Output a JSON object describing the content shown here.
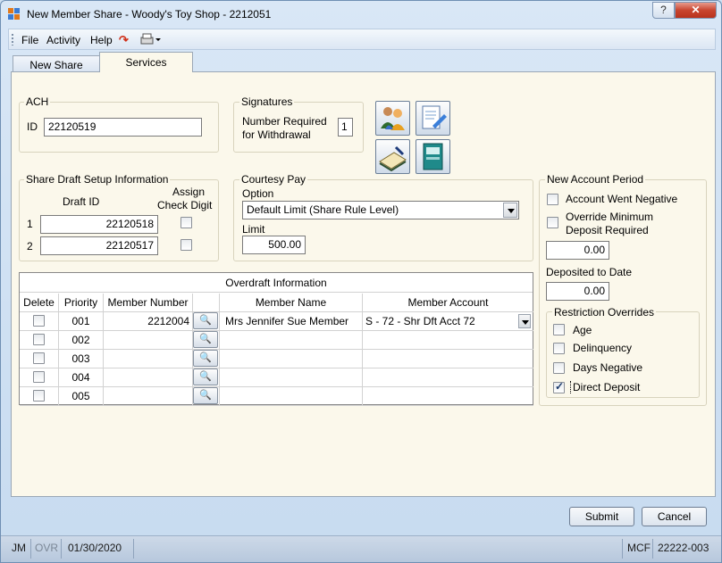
{
  "window": {
    "title": "New Member Share - Woody's Toy Shop - 2212051",
    "help_label": "?",
    "close_label": "✕"
  },
  "menu": {
    "file": "File",
    "activity": "Activity",
    "help": "Help"
  },
  "tabs": [
    {
      "label": "New Share",
      "active": false
    },
    {
      "label": "Services",
      "active": true
    }
  ],
  "ach": {
    "group_label": "ACH",
    "id_label": "ID",
    "id_value": "22120519"
  },
  "signatures": {
    "group_label": "Signatures",
    "required_label_1": "Number Required",
    "required_label_2": "for Withdrawal",
    "required_value": "1"
  },
  "share_draft": {
    "group_label": "Share Draft Setup Information",
    "draft_id_header": "Draft ID",
    "assign_header_1": "Assign",
    "assign_header_2": "Check Digit",
    "rows": [
      {
        "num": "1",
        "draft_id": "22120518",
        "assign": false
      },
      {
        "num": "2",
        "draft_id": "22120517",
        "assign": false
      }
    ]
  },
  "courtesy_pay": {
    "group_label": "Courtesy Pay",
    "option_label": "Option",
    "option_value": "Default Limit (Share Rule Level)",
    "limit_label": "Limit",
    "limit_value": "500.00"
  },
  "new_account_period": {
    "group_label": "New Account Period",
    "went_negative_label": "Account Went Negative",
    "override_label_1": "Override Minimum",
    "override_label_2": "Deposit Required",
    "min_deposit_value": "0.00",
    "deposited_to_date_label": "Deposited to Date",
    "deposited_to_date_value": "0.00",
    "restriction_overrides": {
      "group_label": "Restriction Overrides",
      "items": [
        {
          "label": "Age",
          "checked": false
        },
        {
          "label": "Delinquency",
          "checked": false
        },
        {
          "label": "Days Negative",
          "checked": false
        },
        {
          "label": "Direct Deposit",
          "checked": true
        }
      ]
    }
  },
  "overdraft": {
    "title": "Overdraft Information",
    "headers": {
      "delete": "Delete",
      "priority": "Priority",
      "member_number": "Member Number",
      "member_name": "Member Name",
      "member_account": "Member Account"
    },
    "rows": [
      {
        "priority": "001",
        "member_number": "2212004",
        "member_name": "Mrs Jennifer Sue Member",
        "member_account": "S - 72 - Shr Dft Acct 72"
      },
      {
        "priority": "002",
        "member_number": "",
        "member_name": "",
        "member_account": ""
      },
      {
        "priority": "003",
        "member_number": "",
        "member_name": "",
        "member_account": ""
      },
      {
        "priority": "004",
        "member_number": "",
        "member_name": "",
        "member_account": ""
      },
      {
        "priority": "005",
        "member_number": "",
        "member_name": "",
        "member_account": ""
      }
    ]
  },
  "buttons": {
    "submit": "Submit",
    "cancel": "Cancel"
  },
  "status": {
    "user": "JM",
    "ovr": "OVR",
    "date": "01/30/2020",
    "mode": "MCF",
    "account": "22222-003"
  }
}
